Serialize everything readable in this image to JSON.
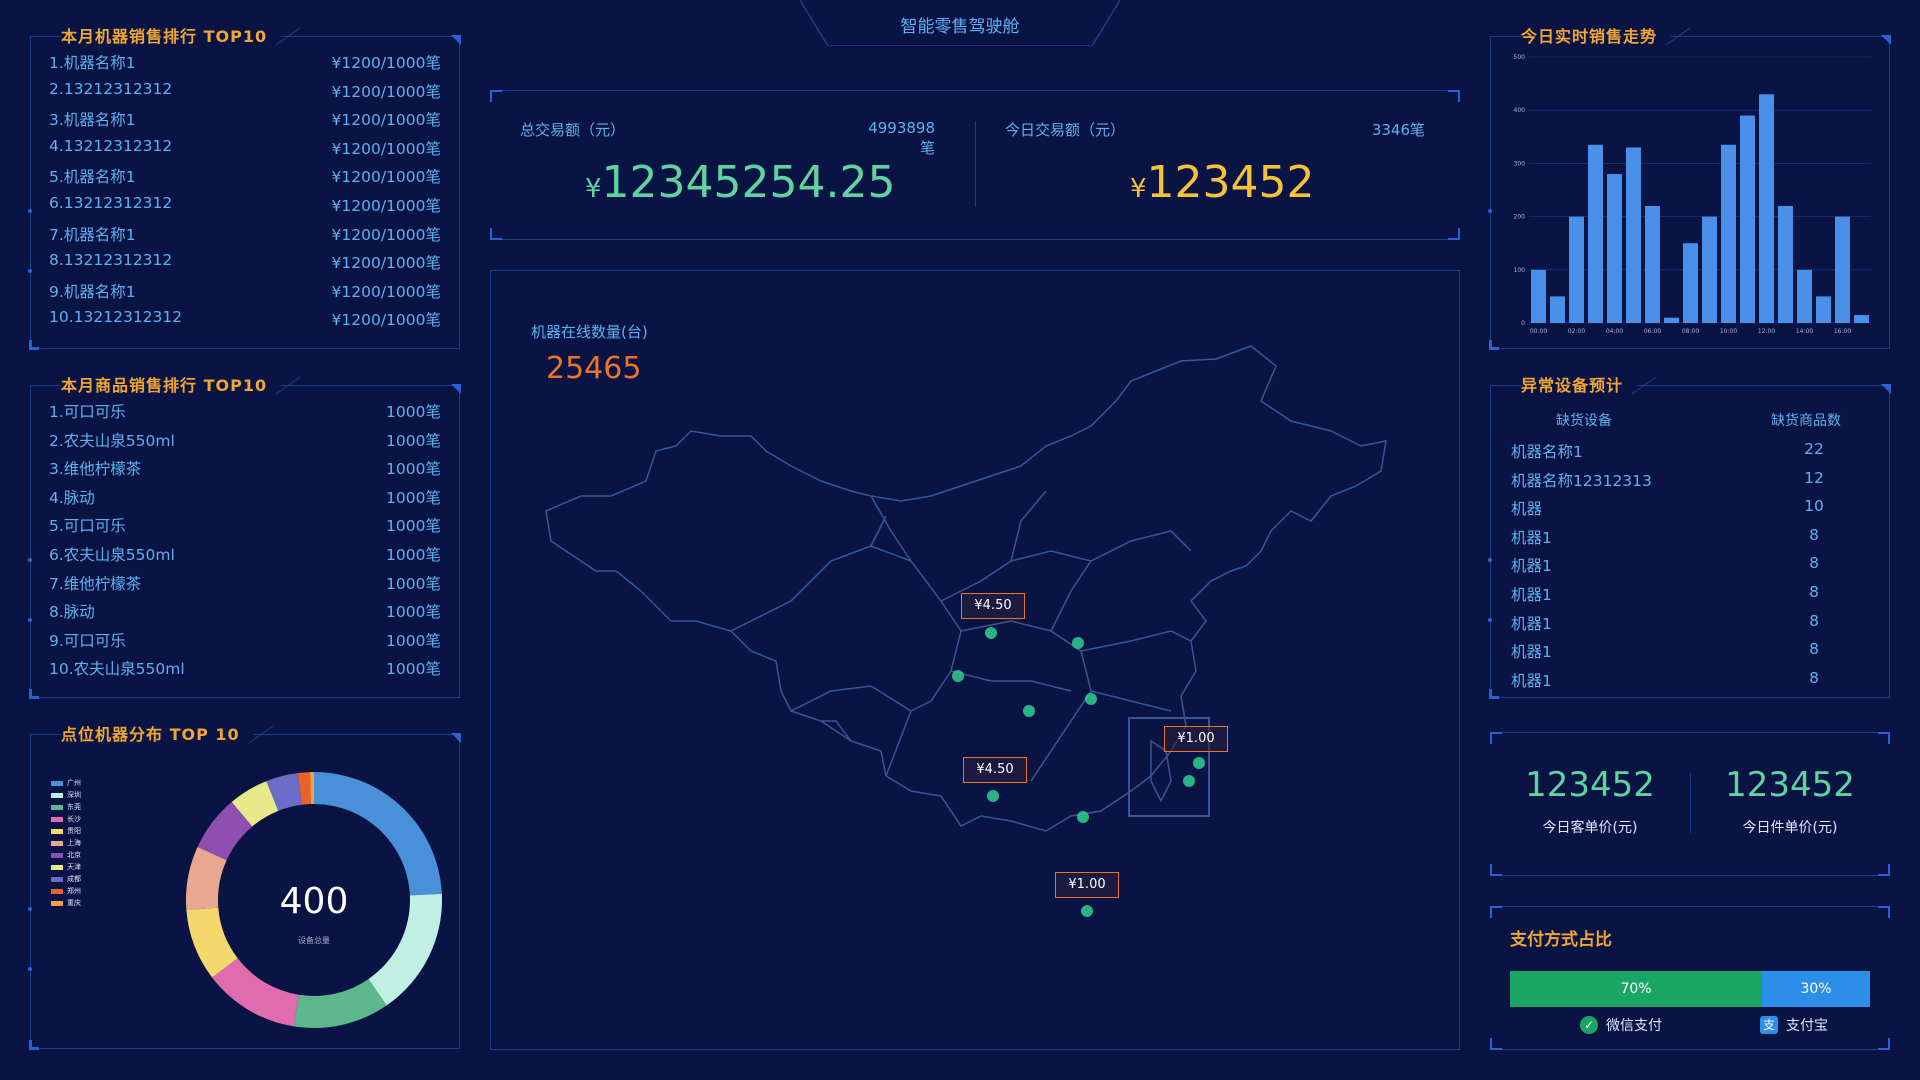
{
  "header": {
    "title": "智能零售驾驶舱"
  },
  "machine_rank": {
    "title": "本月机器销售排行 TOP10",
    "rows": [
      {
        "name": "1.机器名称1",
        "value": "¥1200/1000笔"
      },
      {
        "name": "2.13212312312",
        "value": "¥1200/1000笔"
      },
      {
        "name": "3.机器名称1",
        "value": "¥1200/1000笔"
      },
      {
        "name": "4.13212312312",
        "value": "¥1200/1000笔"
      },
      {
        "name": "5.机器名称1",
        "value": "¥1200/1000笔"
      },
      {
        "name": "6.13212312312",
        "value": "¥1200/1000笔"
      },
      {
        "name": "7.机器名称1",
        "value": "¥1200/1000笔"
      },
      {
        "name": "8.13212312312",
        "value": "¥1200/1000笔"
      },
      {
        "name": "9.机器名称1",
        "value": "¥1200/1000笔"
      },
      {
        "name": "10.13212312312",
        "value": "¥1200/1000笔"
      }
    ]
  },
  "goods_rank": {
    "title": "本月商品销售排行 TOP10",
    "rows": [
      {
        "name": "1.可口可乐",
        "value": "1000笔"
      },
      {
        "name": "2.农夫山泉550ml",
        "value": "1000笔"
      },
      {
        "name": "3.维他柠檬茶",
        "value": "1000笔"
      },
      {
        "name": "4.脉动",
        "value": "1000笔"
      },
      {
        "name": "5.可口可乐",
        "value": "1000笔"
      },
      {
        "name": "6.农夫山泉550ml",
        "value": "1000笔"
      },
      {
        "name": "7.维他柠檬茶",
        "value": "1000笔"
      },
      {
        "name": "8.脉动",
        "value": "1000笔"
      },
      {
        "name": "9.可口可乐",
        "value": "1000笔"
      },
      {
        "name": "10.农夫山泉550ml",
        "value": "1000笔"
      }
    ]
  },
  "distribution": {
    "title": "点位机器分布 TOP 10",
    "total": "400",
    "total_label": "设备总量",
    "legend": [
      {
        "name": "广州",
        "color": "#4a90d9"
      },
      {
        "name": "深圳",
        "color": "#bff0e2"
      },
      {
        "name": "东莞",
        "color": "#5cb88c"
      },
      {
        "name": "长沙",
        "color": "#e06cae"
      },
      {
        "name": "贵阳",
        "color": "#f5d86b"
      },
      {
        "name": "上海",
        "color": "#e8a890"
      },
      {
        "name": "北京",
        "color": "#8e4fb0"
      },
      {
        "name": "天津",
        "color": "#e6e88a"
      },
      {
        "name": "成都",
        "color": "#6a6cc8"
      },
      {
        "name": "郑州",
        "color": "#e8622a"
      },
      {
        "name": "重庆",
        "color": "#f0a040"
      }
    ]
  },
  "chart_data": [
    {
      "type": "pie",
      "title": "点位机器分布 TOP 10",
      "categories": [
        "广州",
        "深圳",
        "东莞",
        "长沙",
        "贵阳",
        "上海",
        "北京",
        "天津",
        "成都",
        "郑州",
        "重庆"
      ],
      "values": [
        24,
        16,
        12,
        12,
        9,
        8,
        7,
        5,
        4,
        1.5,
        0.5
      ]
    },
    {
      "type": "bar",
      "title": "今日实时销售走势",
      "categories": [
        "00:00",
        "01:00",
        "02:00",
        "03:00",
        "04:00",
        "05:00",
        "06:00",
        "07:00",
        "08:00",
        "09:00",
        "10:00",
        "11:00",
        "12:00",
        "13:00",
        "14:00",
        "15:00",
        "16:00",
        "17:00"
      ],
      "values": [
        100,
        50,
        200,
        335,
        280,
        330,
        220,
        10,
        150,
        200,
        335,
        390,
        430,
        220,
        100,
        50,
        200,
        15
      ],
      "ylim": [
        0,
        500
      ],
      "yticks": [
        "0",
        "100",
        "200",
        "300",
        "400",
        "500"
      ],
      "xticks": [
        "00:00",
        "02:00",
        "04:00",
        "06:00",
        "08:00",
        "10:00",
        "12:00",
        "14:00",
        "16:00"
      ]
    },
    {
      "type": "bar",
      "title": "支付方式占比",
      "categories": [
        "微信支付",
        "支付宝"
      ],
      "values": [
        70,
        30
      ]
    }
  ],
  "totals": {
    "total_label": "总交易额（元）",
    "total_count": "4993898笔",
    "total_value": "12345254.25",
    "today_label": "今日交易额（元）",
    "today_count": "3346笔",
    "today_value": "123452",
    "currency": "¥"
  },
  "map": {
    "online_label": "机器在线数量(台)",
    "online_value": "25465",
    "markers": [
      {
        "label": "¥4.50"
      },
      {
        "label": "¥1.00"
      },
      {
        "label": "¥4.50"
      },
      {
        "label": "¥1.00"
      }
    ]
  },
  "realtime": {
    "title": "今日实时销售走势"
  },
  "abnormal": {
    "title": "异常设备预计",
    "col1": "缺货设备",
    "col2": "缺货商品数",
    "rows": [
      {
        "name": "机器名称1",
        "count": "22"
      },
      {
        "name": "机器名称12312313",
        "count": "12"
      },
      {
        "name": "机器",
        "count": "10"
      },
      {
        "name": "机器1",
        "count": "8"
      },
      {
        "name": "机器1",
        "count": "8"
      },
      {
        "name": "机器1",
        "count": "8"
      },
      {
        "name": "机器1",
        "count": "8"
      },
      {
        "name": "机器1",
        "count": "8"
      },
      {
        "name": "机器1",
        "count": "8"
      }
    ]
  },
  "unit_price": {
    "customer_value": "123452",
    "customer_label": "今日客单价(元)",
    "item_value": "123452",
    "item_label": "今日件单价(元)"
  },
  "payment": {
    "title": "支付方式占比",
    "wechat_pct": "70%",
    "alipay_pct": "30%",
    "wechat_label": "微信支付",
    "alipay_label": "支付宝",
    "wechat_color": "#1aa565",
    "alipay_color": "#2b8ee8"
  }
}
